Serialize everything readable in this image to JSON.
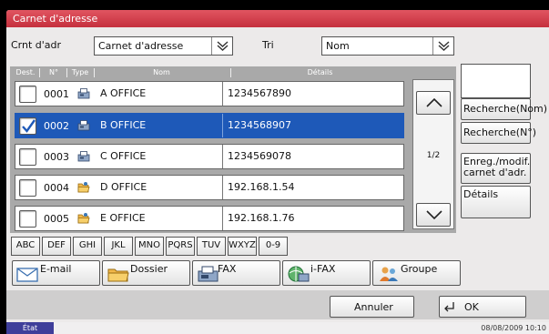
{
  "window": {
    "title": "Carnet d'adresse"
  },
  "top": {
    "current_label": "Crnt d'adr",
    "current_value": "Carnet d'adresse",
    "sort_label": "Tri",
    "sort_value": "Nom"
  },
  "columns": {
    "dest": "Dest.",
    "number": "N°",
    "type": "Type",
    "name": "Nom",
    "details": "Détails"
  },
  "rows": [
    {
      "number": "0001",
      "type_icon": "fax-icon",
      "name": "A OFFICE",
      "details": "1234567890",
      "checked": false
    },
    {
      "number": "0002",
      "type_icon": "fax-icon",
      "name": "B OFFICE",
      "details": "1234568907",
      "checked": true
    },
    {
      "number": "0003",
      "type_icon": "fax-icon",
      "name": "C OFFICE",
      "details": "1234569078",
      "checked": false
    },
    {
      "number": "0004",
      "type_icon": "folder-icon",
      "name": "D OFFICE",
      "details": "192.168.1.54",
      "checked": false
    },
    {
      "number": "0005",
      "type_icon": "folder-icon",
      "name": "E OFFICE",
      "details": "192.168.1.76",
      "checked": false
    }
  ],
  "pager": {
    "page": "1/2"
  },
  "side_buttons": {
    "search_name": "Recherche(Nom)",
    "search_number": "Recherche(N°)",
    "register_line1": "Enreg./modif.",
    "register_line2": "carnet d'adr.",
    "details": "Détails"
  },
  "alpha_tabs": [
    "ABC",
    "DEF",
    "GHI",
    "JKL",
    "MNO",
    "PQRS",
    "TUV",
    "WXYZ",
    "0-9"
  ],
  "filters": {
    "email": "E-mail",
    "folder": "Dossier",
    "fax": "FAX",
    "ifax": "i-FAX",
    "group": "Groupe"
  },
  "footer": {
    "cancel": "Annuler",
    "ok": "OK"
  },
  "status": {
    "state": "État",
    "datetime": "08/08/2009  10:10"
  },
  "colors": {
    "title_bar": "#d13e4b",
    "selection": "#1e59b8",
    "status_label": "#3e3e9a"
  }
}
